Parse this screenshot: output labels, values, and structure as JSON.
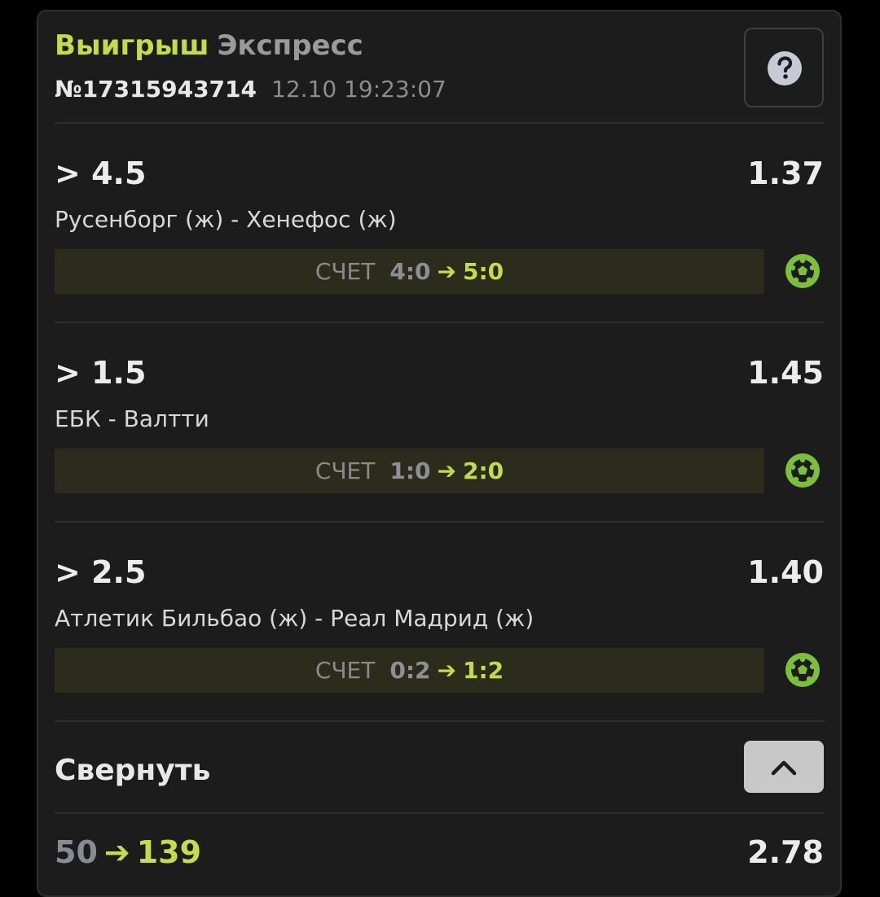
{
  "header": {
    "status": "Выигрыш",
    "bet_type": "Экспресс",
    "bet_number": "№17315943714",
    "datetime": "12.10 19:23:07",
    "help_icon": "question-circle-icon"
  },
  "colors": {
    "accent": "#c4dc4a",
    "card_bg": "#1c1c1c",
    "score_bar_bg": "#2b2c1c",
    "sport_icon": "#7bbf3a"
  },
  "bets": [
    {
      "market": "> 4.5",
      "odds": "1.37",
      "match": "Русенборг (ж) - Хенефос (ж)",
      "score_label": "СЧЕТ",
      "score_from": "4:0",
      "score_to": "5:0",
      "sport_icon": "football-icon"
    },
    {
      "market": "> 1.5",
      "odds": "1.45",
      "match": "ЕБК - Валтти",
      "score_label": "СЧЕТ",
      "score_from": "1:0",
      "score_to": "2:0",
      "sport_icon": "football-icon"
    },
    {
      "market": "> 2.5",
      "odds": "1.40",
      "match": "Атлетик Бильбао (ж) - Реал Мадрид (ж)",
      "score_label": "СЧЕТ",
      "score_from": "0:2",
      "score_to": "1:2",
      "sport_icon": "football-icon"
    }
  ],
  "collapse": {
    "label": "Свернуть",
    "icon": "chevron-up-icon"
  },
  "footer": {
    "stake": "50",
    "payout": "139",
    "total_odds": "2.78"
  }
}
